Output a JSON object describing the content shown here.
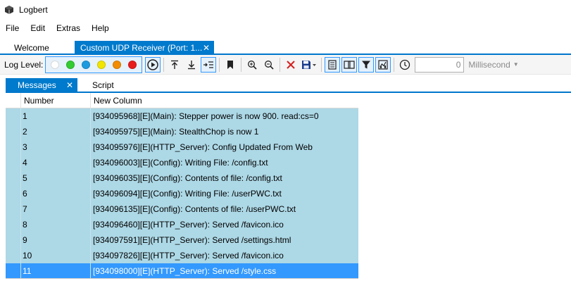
{
  "app": {
    "title": "Logbert"
  },
  "menu": [
    "File",
    "Edit",
    "Extras",
    "Help"
  ],
  "doc_tabs": {
    "welcome": "Welcome",
    "active": "Custom UDP Receiver (Port: 1...",
    "close": "✕"
  },
  "toolbar": {
    "log_level_label": "Log Level:",
    "levels": [
      {
        "name": "trace",
        "color": "#ffffff"
      },
      {
        "name": "debug",
        "color": "#33cc33"
      },
      {
        "name": "info",
        "color": "#1e9be0"
      },
      {
        "name": "warning",
        "color": "#f2e600"
      },
      {
        "name": "error",
        "color": "#f28c00"
      },
      {
        "name": "fatal",
        "color": "#e81b1b"
      }
    ],
    "time_value": "0",
    "time_unit": "Millisecond"
  },
  "inner_tabs": {
    "messages": "Messages",
    "script": "Script",
    "close": "✕"
  },
  "grid": {
    "columns": [
      "Number",
      "New Column"
    ],
    "rows": [
      {
        "number": "1",
        "message": "[934095968][E](Main): Stepper power is now 900.  read:cs=0"
      },
      {
        "number": "2",
        "message": "[934095975][E](Main): StealthChop is now 1"
      },
      {
        "number": "3",
        "message": "[934095976][E](HTTP_Server): Config Updated From Web"
      },
      {
        "number": "4",
        "message": "[934096003][E](Config): Writing File: /config.txt"
      },
      {
        "number": "5",
        "message": "[934096035][E](Config): Contents of file: /config.txt"
      },
      {
        "number": "6",
        "message": "[934096094][E](Config): Writing File: /userPWC.txt"
      },
      {
        "number": "7",
        "message": "[934096135][E](Config): Contents of file: /userPWC.txt"
      },
      {
        "number": "8",
        "message": "[934096460][E](HTTP_Server): Served /favicon.ico"
      },
      {
        "number": "9",
        "message": "[934097591][E](HTTP_Server): Served /settings.html"
      },
      {
        "number": "10",
        "message": "[934097826][E](HTTP_Server): Served /favicon.ico"
      },
      {
        "number": "11",
        "message": "[934098000][E](HTTP_Server): Served /style.css"
      }
    ],
    "selected_row": "11"
  }
}
